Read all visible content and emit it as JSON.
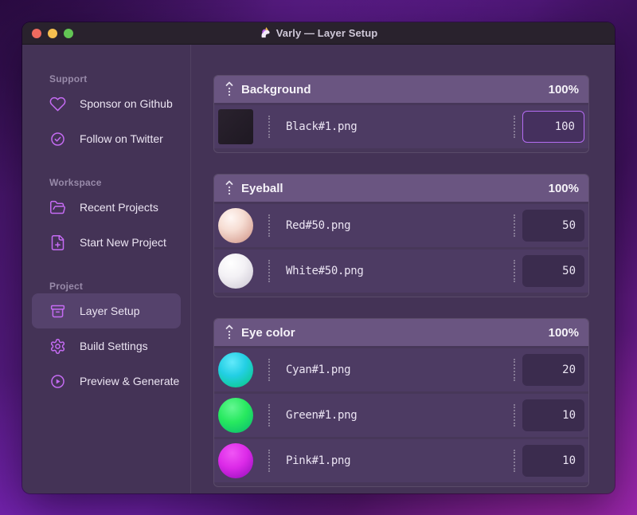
{
  "window": {
    "title": "Varly — Layer Setup",
    "traffic_lights": [
      "close",
      "minimize",
      "zoom"
    ],
    "colors": {
      "accent_icon": "#c56bf3",
      "focus_border": "#b46cf2",
      "group_header_bg": "#6a5581",
      "row_bg": "#4d3b63",
      "window_bg": "#443356",
      "titlebar_bg": "#29222d",
      "traffic_red": "#ee6a5f",
      "traffic_yellow": "#f5bf4f",
      "traffic_green": "#62c554"
    }
  },
  "sidebar": {
    "sections": [
      {
        "title": "Support",
        "items": [
          {
            "label": "Sponsor on Github",
            "icon": "heart-icon"
          },
          {
            "label": "Follow on Twitter",
            "icon": "badge-check-icon"
          }
        ]
      },
      {
        "title": "Workspace",
        "items": [
          {
            "label": "Recent Projects",
            "icon": "folder-open-icon"
          },
          {
            "label": "Start New Project",
            "icon": "file-plus-icon"
          }
        ]
      },
      {
        "title": "Project",
        "items": [
          {
            "label": "Layer Setup",
            "icon": "archive-icon",
            "active": true
          },
          {
            "label": "Build Settings",
            "icon": "gear-icon"
          },
          {
            "label": "Preview & Generate",
            "icon": "play-circle-icon"
          }
        ]
      }
    ]
  },
  "layers": {
    "groups": [
      {
        "name": "Background",
        "weight": "100%",
        "rows": [
          {
            "file": "Black#1.png",
            "value": "100",
            "thumb": "black-square",
            "focused": true
          }
        ]
      },
      {
        "name": "Eyeball",
        "weight": "100%",
        "rows": [
          {
            "file": "Red#50.png",
            "value": "50",
            "thumb": "red-sphere"
          },
          {
            "file": "White#50.png",
            "value": "50",
            "thumb": "white-sphere"
          }
        ]
      },
      {
        "name": "Eye color",
        "weight": "100%",
        "rows": [
          {
            "file": "Cyan#1.png",
            "value": "20",
            "thumb": "cyan-sphere"
          },
          {
            "file": "Green#1.png",
            "value": "10",
            "thumb": "green-sphere"
          },
          {
            "file": "Pink#1.png",
            "value": "10",
            "thumb": "pink-sphere"
          }
        ]
      }
    ]
  }
}
